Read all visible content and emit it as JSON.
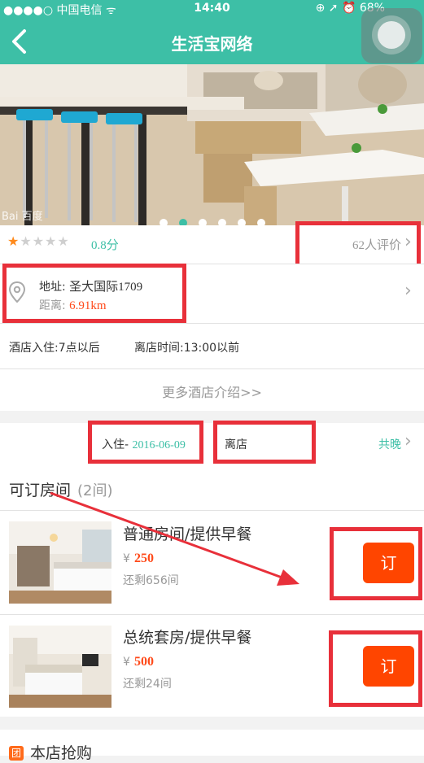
{
  "status": {
    "carrier": "●●●●○ 中国电信",
    "wifi": "ᯤ",
    "time": "14:40",
    "battery": "⊕ ➚ ⏰ 68%"
  },
  "nav": {
    "title": "生活宝网络"
  },
  "gallery": {
    "watermark": "Bai 百度",
    "slide_count": 6,
    "active_index": 1
  },
  "rating": {
    "stars_filled": 1,
    "stars_total": 5,
    "score": "0.8分",
    "reviews": "62人评价"
  },
  "location": {
    "address_label": "地址:",
    "address": "圣大国际1709",
    "distance_label": "距离:",
    "distance": "6.91km"
  },
  "times": {
    "checkin_label": "酒店入住:",
    "checkin": "7点以后",
    "checkout_label": "离店时间:",
    "checkout": "13:00以前"
  },
  "more": {
    "label": "更多酒店介绍>>"
  },
  "booking": {
    "checkin_label": "入住-",
    "checkin_date": "2016-06-09",
    "checkout_label": "离店",
    "nights": "共晚"
  },
  "rooms": {
    "title": "可订房间",
    "count": "(2间)",
    "items": [
      {
        "name": "普通房间/提供早餐",
        "currency": "¥",
        "price": "250",
        "remaining": "还剩656间",
        "book_label": "订"
      },
      {
        "name": "总统套房/提供早餐",
        "currency": "¥",
        "price": "500",
        "remaining": "还剩24间",
        "book_label": "订"
      }
    ]
  },
  "group_buy": {
    "icon_text": "团",
    "title": "本店抢购"
  },
  "colors": {
    "accent": "#3dbfa6",
    "price": "#ff4a1a",
    "book_button": "#ff4500",
    "annotation": "#e8303a"
  }
}
